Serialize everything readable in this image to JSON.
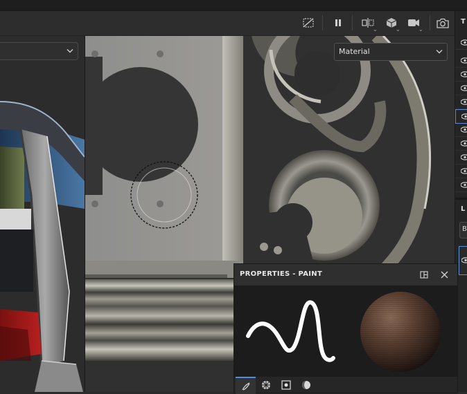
{
  "viewport": {
    "material_dropdown": {
      "value": "Material"
    }
  },
  "properties_panel": {
    "title": "PROPERTIES - PAINT"
  },
  "right_panel": {
    "header_letter": "T",
    "section_letter": "L",
    "row_letter": "B"
  },
  "toolbar": {
    "icons": [
      "hide-icon",
      "pause-icon",
      "split-view-icon",
      "cube-icon",
      "camera-icon",
      "screenshot-icon"
    ]
  }
}
